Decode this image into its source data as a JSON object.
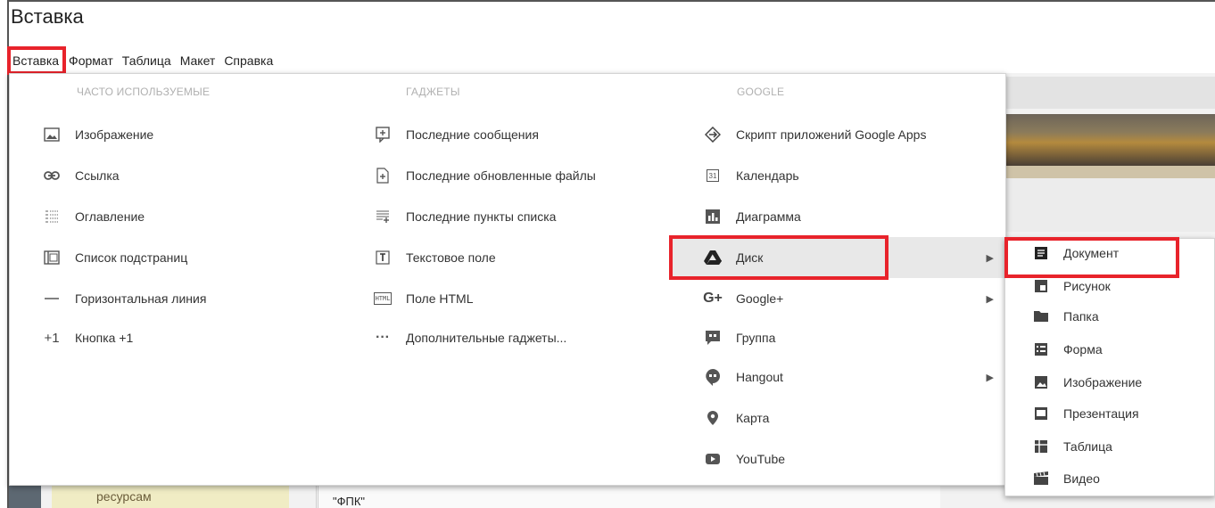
{
  "window": {
    "title": "Вставка"
  },
  "menubar": {
    "items": [
      "Вставка",
      "Формат",
      "Таблица",
      "Макет",
      "Справка"
    ]
  },
  "insert_menu": {
    "columns": [
      {
        "heading": "ЧАСТО ИСПОЛЬЗУЕМЫЕ",
        "items": [
          {
            "label": "Изображение",
            "icon": "image-icon"
          },
          {
            "label": "Ссылка",
            "icon": "link-icon"
          },
          {
            "label": "Оглавление",
            "icon": "table-of-contents-icon"
          },
          {
            "label": "Список подстраниц",
            "icon": "subpages-icon"
          },
          {
            "label": "Горизонтальная линия",
            "icon": "horizontal-line-icon"
          },
          {
            "label": "Кнопка +1",
            "icon": "plus-one-icon",
            "glyph": "+1"
          }
        ]
      },
      {
        "heading": "ГАДЖЕТЫ",
        "items": [
          {
            "label": "Последние сообщения",
            "icon": "recent-posts-icon"
          },
          {
            "label": "Последние обновленные файлы",
            "icon": "recent-files-icon"
          },
          {
            "label": "Последние пункты списка",
            "icon": "recent-list-items-icon"
          },
          {
            "label": "Текстовое поле",
            "icon": "text-box-icon"
          },
          {
            "label": "Поле HTML",
            "icon": "html-box-icon",
            "glyph": "HTML"
          },
          {
            "label": "Дополнительные гаджеты...",
            "icon": "more-gadgets-icon",
            "glyph": "···"
          }
        ]
      },
      {
        "heading": "GOOGLE",
        "items": [
          {
            "label": "Скрипт приложений Google Apps",
            "icon": "apps-script-icon"
          },
          {
            "label": "Календарь",
            "icon": "calendar-icon",
            "glyph": "31"
          },
          {
            "label": "Диаграмма",
            "icon": "chart-icon"
          },
          {
            "label": "Диск",
            "icon": "drive-icon",
            "submenu": true,
            "selected": true
          },
          {
            "label": "Google+",
            "icon": "google-plus-icon",
            "glyph": "G+",
            "submenu": true
          },
          {
            "label": "Группа",
            "icon": "groups-icon"
          },
          {
            "label": "Hangout",
            "icon": "hangout-icon",
            "submenu": true
          },
          {
            "label": "Карта",
            "icon": "map-pin-icon"
          },
          {
            "label": "YouTube",
            "icon": "youtube-icon"
          }
        ]
      }
    ]
  },
  "drive_submenu": {
    "items": [
      {
        "label": "Документ",
        "icon": "document-icon",
        "selected": true
      },
      {
        "label": "Рисунок",
        "icon": "drawing-icon"
      },
      {
        "label": "Папка",
        "icon": "folder-icon"
      },
      {
        "label": "Форма",
        "icon": "form-icon"
      },
      {
        "label": "Изображение",
        "icon": "image-icon"
      },
      {
        "label": "Презентация",
        "icon": "presentation-icon"
      },
      {
        "label": "Таблица",
        "icon": "spreadsheet-icon"
      },
      {
        "label": "Видео",
        "icon": "video-icon"
      }
    ]
  },
  "background_page": {
    "sidebar_text": "ресурсам",
    "content_text": "\"ФПК\""
  },
  "colors": {
    "highlight_red": "#e8232b",
    "selected_row": "#e8e8e8"
  }
}
